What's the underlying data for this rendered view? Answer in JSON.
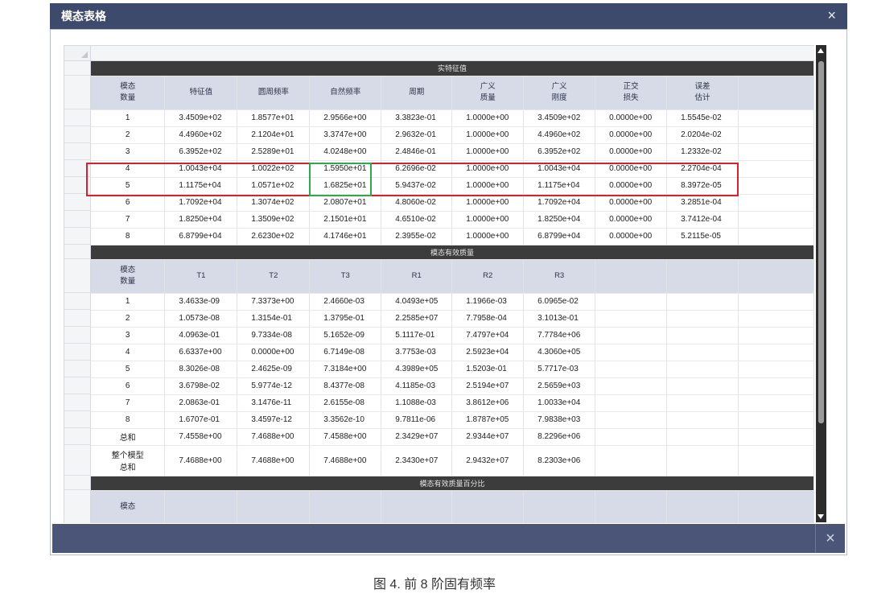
{
  "window": {
    "title": "模态表格",
    "close_symbol": "×"
  },
  "sections": {
    "eigen": "实特征值",
    "mass": "模态有效质量",
    "mass_pct": "模态有效质量百分比"
  },
  "eigen_headers": [
    "模态\n数量",
    "特征值",
    "圆周频率",
    "自然频率",
    "周期",
    "广义\n质量",
    "广义\n刚度",
    "正交\n损失",
    "误差\n估计"
  ],
  "eigen_rows": [
    [
      "1",
      "3.4509e+02",
      "1.8577e+01",
      "2.9566e+00",
      "3.3823e-01",
      "1.0000e+00",
      "3.4509e+02",
      "0.0000e+00",
      "1.5545e-02"
    ],
    [
      "2",
      "4.4960e+02",
      "2.1204e+01",
      "3.3747e+00",
      "2.9632e-01",
      "1.0000e+00",
      "4.4960e+02",
      "0.0000e+00",
      "2.0204e-02"
    ],
    [
      "3",
      "6.3952e+02",
      "2.5289e+01",
      "4.0248e+00",
      "2.4846e-01",
      "1.0000e+00",
      "6.3952e+02",
      "0.0000e+00",
      "1.2332e-02"
    ],
    [
      "4",
      "1.0043e+04",
      "1.0022e+02",
      "1.5950e+01",
      "6.2696e-02",
      "1.0000e+00",
      "1.0043e+04",
      "0.0000e+00",
      "2.2704e-04"
    ],
    [
      "5",
      "1.1175e+04",
      "1.0571e+02",
      "1.6825e+01",
      "5.9437e-02",
      "1.0000e+00",
      "1.1175e+04",
      "0.0000e+00",
      "8.3972e-05"
    ],
    [
      "6",
      "1.7092e+04",
      "1.3074e+02",
      "2.0807e+01",
      "4.8060e-02",
      "1.0000e+00",
      "1.7092e+04",
      "0.0000e+00",
      "3.2851e-04"
    ],
    [
      "7",
      "1.8250e+04",
      "1.3509e+02",
      "2.1501e+01",
      "4.6510e-02",
      "1.0000e+00",
      "1.8250e+04",
      "0.0000e+00",
      "3.7412e-04"
    ],
    [
      "8",
      "6.8799e+04",
      "2.6230e+02",
      "4.1746e+01",
      "2.3955e-02",
      "1.0000e+00",
      "6.8799e+04",
      "0.0000e+00",
      "5.2115e-05"
    ]
  ],
  "mass_headers": [
    "模态\n数量",
    "T1",
    "T2",
    "T3",
    "R1",
    "R2",
    "R3",
    "",
    ""
  ],
  "mass_rows": [
    [
      "1",
      "3.4633e-09",
      "7.3373e+00",
      "2.4660e-03",
      "4.0493e+05",
      "1.1966e-03",
      "6.0965e-02",
      "",
      ""
    ],
    [
      "2",
      "1.0573e-08",
      "1.3154e-01",
      "1.3795e-01",
      "2.2585e+07",
      "7.7958e-04",
      "3.1013e-01",
      "",
      ""
    ],
    [
      "3",
      "4.0963e-01",
      "9.7334e-08",
      "5.1652e-09",
      "5.1117e-01",
      "7.4797e+04",
      "7.7784e+06",
      "",
      ""
    ],
    [
      "4",
      "6.6337e+00",
      "0.0000e+00",
      "6.7149e-08",
      "3.7753e-03",
      "2.5923e+04",
      "4.3060e+05",
      "",
      ""
    ],
    [
      "5",
      "8.3026e-08",
      "2.4625e-09",
      "7.3184e+00",
      "4.3989e+05",
      "1.5203e-01",
      "5.7717e-03",
      "",
      ""
    ],
    [
      "6",
      "3.6798e-02",
      "5.9774e-12",
      "8.4377e-08",
      "4.1185e-03",
      "2.5194e+07",
      "2.5659e+03",
      "",
      ""
    ],
    [
      "7",
      "2.0863e-01",
      "3.1476e-11",
      "2.6155e-08",
      "1.1088e-03",
      "3.8612e+06",
      "1.0033e+04",
      "",
      ""
    ],
    [
      "8",
      "1.6707e-01",
      "3.4597e-12",
      "3.3562e-10",
      "9.7811e-06",
      "1.8787e+05",
      "7.9838e+03",
      "",
      ""
    ],
    [
      "总和",
      "7.4558e+00",
      "7.4688e+00",
      "7.4588e+00",
      "2.3429e+07",
      "2.9344e+07",
      "8.2296e+06",
      "",
      ""
    ]
  ],
  "mass_total_row": [
    "整个模型\n总和",
    "7.4688e+00",
    "7.4688e+00",
    "7.4688e+00",
    "2.3430e+07",
    "2.9432e+07",
    "8.2303e+06",
    "",
    ""
  ],
  "pct_partial_header": "模态",
  "caption": "图 4. 前 8 阶固有频率"
}
